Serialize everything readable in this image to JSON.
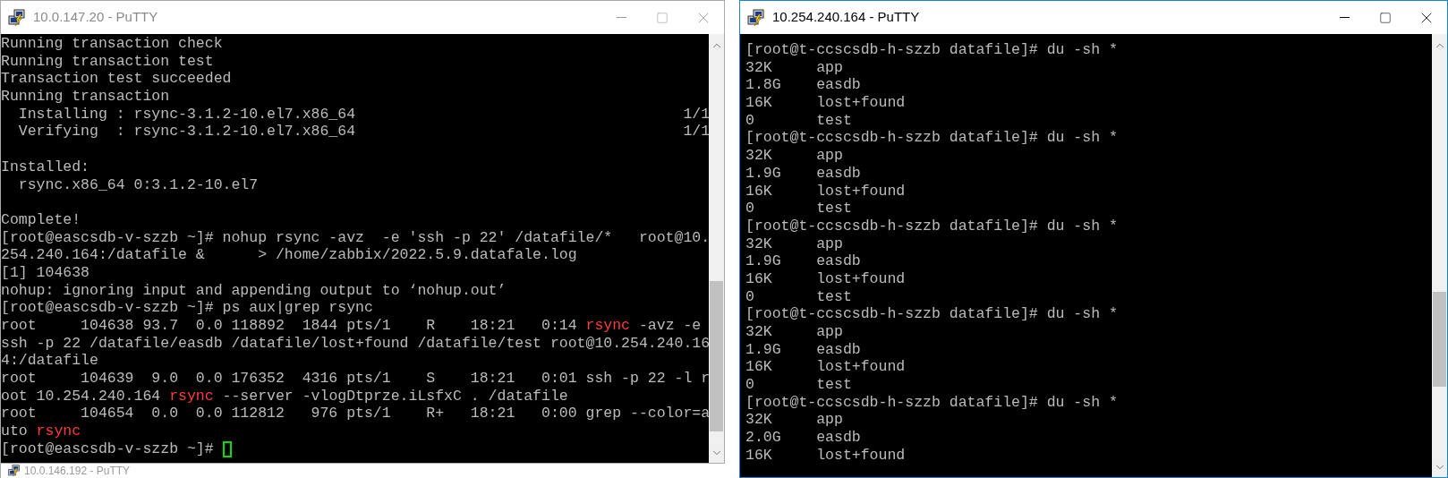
{
  "windows": [
    {
      "title": "10.0.147.20 - PuTTY",
      "active": false,
      "cursor": true,
      "lines": [
        {
          "kind": "text",
          "segments": [
            {
              "kind": "plain",
              "text": "Running transaction check"
            }
          ]
        },
        {
          "kind": "text",
          "segments": [
            {
              "kind": "plain",
              "text": "Running transaction test"
            }
          ]
        },
        {
          "kind": "text",
          "segments": [
            {
              "kind": "plain",
              "text": "Transaction test succeeded"
            }
          ]
        },
        {
          "kind": "text",
          "segments": [
            {
              "kind": "plain",
              "text": "Running transaction"
            }
          ]
        },
        {
          "kind": "text",
          "segments": [
            {
              "kind": "plain",
              "text": "  Installing : rsync-3.1.2-10.el7.x86_64                                     1/1"
            }
          ]
        },
        {
          "kind": "text",
          "segments": [
            {
              "kind": "plain",
              "text": "  Verifying  : rsync-3.1.2-10.el7.x86_64                                     1/1"
            }
          ]
        },
        {
          "kind": "blank"
        },
        {
          "kind": "text",
          "segments": [
            {
              "kind": "plain",
              "text": "Installed:"
            }
          ]
        },
        {
          "kind": "text",
          "segments": [
            {
              "kind": "plain",
              "text": "  rsync.x86_64 0:3.1.2-10.el7"
            }
          ]
        },
        {
          "kind": "blank"
        },
        {
          "kind": "text",
          "segments": [
            {
              "kind": "plain",
              "text": "Complete!"
            }
          ]
        },
        {
          "kind": "text",
          "segments": [
            {
              "kind": "plain",
              "text": "[root@eascsdb-v-szzb ~]# nohup rsync -avz  -e 'ssh -p 22' /datafile/*   root@10."
            }
          ]
        },
        {
          "kind": "text",
          "segments": [
            {
              "kind": "plain",
              "text": "254.240.164:/datafile &      > /home/zabbix/2022.5.9.datafale.log"
            }
          ]
        },
        {
          "kind": "text",
          "segments": [
            {
              "kind": "plain",
              "text": "[1] 104638"
            }
          ]
        },
        {
          "kind": "text",
          "segments": [
            {
              "kind": "plain",
              "text": "nohup: ignoring input and appending output to ‘nohup.out’"
            }
          ]
        },
        {
          "kind": "text",
          "segments": [
            {
              "kind": "plain",
              "text": "[root@eascsdb-v-szzb ~]# ps aux|grep rsync"
            }
          ]
        },
        {
          "kind": "text",
          "segments": [
            {
              "kind": "plain",
              "text": "root     104638 93.7  0.0 118892  1844 pts/1    R    18:21   0:14 "
            },
            {
              "kind": "match",
              "text": "rsync"
            },
            {
              "kind": "plain",
              "text": " -avz -e"
            }
          ]
        },
        {
          "kind": "text",
          "segments": [
            {
              "kind": "plain",
              "text": "ssh -p 22 /datafile/easdb /datafile/lost+found /datafile/test root@10.254.240.16"
            }
          ]
        },
        {
          "kind": "text",
          "segments": [
            {
              "kind": "plain",
              "text": "4:/datafile"
            }
          ]
        },
        {
          "kind": "text",
          "segments": [
            {
              "kind": "plain",
              "text": "root     104639  9.0  0.0 176352  4316 pts/1    S    18:21   0:01 ssh -p 22 -l r"
            }
          ]
        },
        {
          "kind": "text",
          "segments": [
            {
              "kind": "plain",
              "text": "oot 10.254.240.164 "
            },
            {
              "kind": "match",
              "text": "rsync"
            },
            {
              "kind": "plain",
              "text": " --server -vlogDtprze.iLsfxC . /datafile"
            }
          ]
        },
        {
          "kind": "text",
          "segments": [
            {
              "kind": "plain",
              "text": "root     104654  0.0  0.0 112812   976 pts/1    R+   18:21   0:00 grep --color=a"
            }
          ]
        },
        {
          "kind": "text",
          "segments": [
            {
              "kind": "plain",
              "text": "uto "
            },
            {
              "kind": "match",
              "text": "rsync"
            }
          ]
        },
        {
          "kind": "text",
          "segments": [
            {
              "kind": "plain",
              "text": "[root@eascsdb-v-szzb ~]# "
            }
          ]
        }
      ]
    },
    {
      "title": "10.254.240.164 - PuTTY",
      "active": true,
      "cursor": false,
      "lines": [
        {
          "kind": "text",
          "segments": [
            {
              "kind": "plain",
              "text": "[root@t-ccscsdb-h-szzb datafile]# du -sh *"
            }
          ]
        },
        {
          "kind": "text",
          "segments": [
            {
              "kind": "plain",
              "text": "32K     app"
            }
          ]
        },
        {
          "kind": "text",
          "segments": [
            {
              "kind": "plain",
              "text": "1.8G    easdb"
            }
          ]
        },
        {
          "kind": "text",
          "segments": [
            {
              "kind": "plain",
              "text": "16K     lost+found"
            }
          ]
        },
        {
          "kind": "text",
          "segments": [
            {
              "kind": "plain",
              "text": "0       test"
            }
          ]
        },
        {
          "kind": "text",
          "segments": [
            {
              "kind": "plain",
              "text": "[root@t-ccscsdb-h-szzb datafile]# du -sh *"
            }
          ]
        },
        {
          "kind": "text",
          "segments": [
            {
              "kind": "plain",
              "text": "32K     app"
            }
          ]
        },
        {
          "kind": "text",
          "segments": [
            {
              "kind": "plain",
              "text": "1.9G    easdb"
            }
          ]
        },
        {
          "kind": "text",
          "segments": [
            {
              "kind": "plain",
              "text": "16K     lost+found"
            }
          ]
        },
        {
          "kind": "text",
          "segments": [
            {
              "kind": "plain",
              "text": "0       test"
            }
          ]
        },
        {
          "kind": "text",
          "segments": [
            {
              "kind": "plain",
              "text": "[root@t-ccscsdb-h-szzb datafile]# du -sh *"
            }
          ]
        },
        {
          "kind": "text",
          "segments": [
            {
              "kind": "plain",
              "text": "32K     app"
            }
          ]
        },
        {
          "kind": "text",
          "segments": [
            {
              "kind": "plain",
              "text": "1.9G    easdb"
            }
          ]
        },
        {
          "kind": "text",
          "segments": [
            {
              "kind": "plain",
              "text": "16K     lost+found"
            }
          ]
        },
        {
          "kind": "text",
          "segments": [
            {
              "kind": "plain",
              "text": "0       test"
            }
          ]
        },
        {
          "kind": "text",
          "segments": [
            {
              "kind": "plain",
              "text": "[root@t-ccscsdb-h-szzb datafile]# du -sh *"
            }
          ]
        },
        {
          "kind": "text",
          "segments": [
            {
              "kind": "plain",
              "text": "32K     app"
            }
          ]
        },
        {
          "kind": "text",
          "segments": [
            {
              "kind": "plain",
              "text": "1.9G    easdb"
            }
          ]
        },
        {
          "kind": "text",
          "segments": [
            {
              "kind": "plain",
              "text": "16K     lost+found"
            }
          ]
        },
        {
          "kind": "text",
          "segments": [
            {
              "kind": "plain",
              "text": "0       test"
            }
          ]
        },
        {
          "kind": "text",
          "segments": [
            {
              "kind": "plain",
              "text": "[root@t-ccscsdb-h-szzb datafile]# du -sh *"
            }
          ]
        },
        {
          "kind": "text",
          "segments": [
            {
              "kind": "plain",
              "text": "32K     app"
            }
          ]
        },
        {
          "kind": "text",
          "segments": [
            {
              "kind": "plain",
              "text": "2.0G    easdb"
            }
          ]
        },
        {
          "kind": "text",
          "segments": [
            {
              "kind": "plain",
              "text": "16K     lost+found"
            }
          ]
        }
      ]
    }
  ],
  "background_window": {
    "title": "10.0.146.192 - PuTTY"
  }
}
